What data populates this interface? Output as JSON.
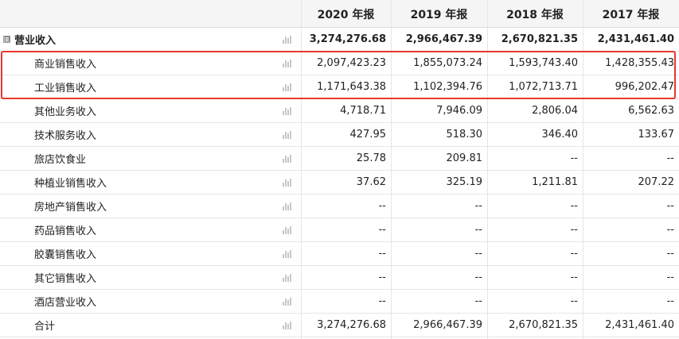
{
  "columns": [
    "2020 年报",
    "2019 年报",
    "2018 年报",
    "2017 年报"
  ],
  "rows": [
    {
      "label": "营业收入",
      "values": [
        "3,274,276.68",
        "2,966,467.39",
        "2,670,821.35",
        "2,431,461.40"
      ]
    },
    {
      "label": "商业销售收入",
      "values": [
        "2,097,423.23",
        "1,855,073.24",
        "1,593,743.40",
        "1,428,355.43"
      ]
    },
    {
      "label": "工业销售收入",
      "values": [
        "1,171,643.38",
        "1,102,394.76",
        "1,072,713.71",
        "996,202.47"
      ]
    },
    {
      "label": "其他业务收入",
      "values": [
        "4,718.71",
        "7,946.09",
        "2,806.04",
        "6,562.63"
      ]
    },
    {
      "label": "技术服务收入",
      "values": [
        "427.95",
        "518.30",
        "346.40",
        "133.67"
      ]
    },
    {
      "label": "旅店饮食业",
      "values": [
        "25.78",
        "209.81",
        "--",
        "--"
      ]
    },
    {
      "label": "种植业销售收入",
      "values": [
        "37.62",
        "325.19",
        "1,211.81",
        "207.22"
      ]
    },
    {
      "label": "房地产销售收入",
      "values": [
        "--",
        "--",
        "--",
        "--"
      ]
    },
    {
      "label": "药品销售收入",
      "values": [
        "--",
        "--",
        "--",
        "--"
      ]
    },
    {
      "label": "胶囊销售收入",
      "values": [
        "--",
        "--",
        "--",
        "--"
      ]
    },
    {
      "label": "其它销售收入",
      "values": [
        "--",
        "--",
        "--",
        "--"
      ]
    },
    {
      "label": "酒店营业收入",
      "values": [
        "--",
        "--",
        "--",
        "--"
      ]
    },
    {
      "label": "合计",
      "values": [
        "3,274,276.68",
        "2,966,467.39",
        "2,670,821.35",
        "2,431,461.40"
      ]
    }
  ],
  "collapse_toggle": "⊟",
  "icons": {
    "row_chart": "bar-chart-icon"
  },
  "colors": {
    "highlight": "#e8372d",
    "header_bg": "#f5f5f5"
  }
}
